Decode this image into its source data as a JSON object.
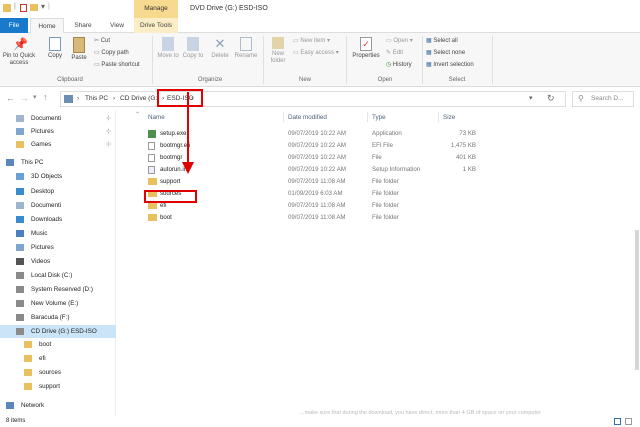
{
  "window": {
    "title": "DVD Drive (G:) ESD-ISO",
    "context_tab": "Manage"
  },
  "tabs": [
    "File",
    "Home",
    "Share",
    "View",
    "Drive Tools"
  ],
  "ribbon": {
    "clipboard": {
      "label": "Clipboard",
      "pin": "Pin to Quick access",
      "copy": "Copy",
      "paste": "Paste",
      "cut": "Cut",
      "copy_path": "Copy path",
      "paste_shortcut": "Paste shortcut"
    },
    "organize": {
      "label": "Organize",
      "move_to": "Move to",
      "copy_to": "Copy to",
      "delete": "Delete",
      "rename": "Rename"
    },
    "new": {
      "label": "New",
      "new_folder": "New folder",
      "new_item": "New item",
      "easy_access": "Easy access"
    },
    "open": {
      "label": "Open",
      "properties": "Properties",
      "open": "Open",
      "edit": "Edit",
      "history": "History"
    },
    "select": {
      "label": "Select",
      "select_all": "Select all",
      "select_none": "Select none",
      "invert": "Invert selection"
    }
  },
  "address": {
    "crumbs": [
      "This PC",
      "CD Drive (G:)",
      "ESD-ISO"
    ],
    "search_placeholder": "Search D..."
  },
  "nav": [
    {
      "label": "Documenti",
      "icon": "document-folder-icon",
      "pinned": true
    },
    {
      "label": "Pictures",
      "icon": "pictures-folder-icon",
      "pinned": true
    },
    {
      "label": "Games",
      "icon": "folder-icon",
      "pinned": true
    },
    {
      "label": "This PC",
      "icon": "computer-icon"
    },
    {
      "label": "3D Objects",
      "icon": "3d-objects-icon"
    },
    {
      "label": "Desktop",
      "icon": "desktop-icon"
    },
    {
      "label": "Documenti",
      "icon": "document-folder-icon"
    },
    {
      "label": "Downloads",
      "icon": "downloads-icon"
    },
    {
      "label": "Music",
      "icon": "music-icon"
    },
    {
      "label": "Pictures",
      "icon": "pictures-folder-icon"
    },
    {
      "label": "Videos",
      "icon": "videos-icon"
    },
    {
      "label": "Local Disk (C:)",
      "icon": "drive-icon"
    },
    {
      "label": "System Reserved (D:)",
      "icon": "drive-icon"
    },
    {
      "label": "New Volume (E:)",
      "icon": "drive-icon"
    },
    {
      "label": "Baracuda (F:)",
      "icon": "drive-icon"
    },
    {
      "label": "CD Drive (G:) ESD-ISO",
      "icon": "cd-drive-icon",
      "selected": true
    },
    {
      "label": "boot",
      "icon": "folder-icon"
    },
    {
      "label": "efi",
      "icon": "folder-icon"
    },
    {
      "label": "sources",
      "icon": "folder-icon"
    },
    {
      "label": "support",
      "icon": "folder-icon"
    },
    {
      "label": "Network",
      "icon": "network-icon"
    }
  ],
  "columns": [
    "Name",
    "Date modified",
    "Type",
    "Size"
  ],
  "files": [
    {
      "name": "setup.exe",
      "date": "09/07/2019 10:22 AM",
      "type": "Application",
      "size": "73 KB",
      "icon": "setup-icon"
    },
    {
      "name": "bootmgr.efi",
      "date": "09/07/2019 10:22 AM",
      "type": "EFI File",
      "size": "1,475 KB",
      "icon": "file-icon"
    },
    {
      "name": "bootmgr",
      "date": "09/07/2019 10:22 AM",
      "type": "File",
      "size": "401 KB",
      "icon": "file-icon"
    },
    {
      "name": "autorun.inf",
      "date": "09/07/2019 10:22 AM",
      "type": "Setup Information",
      "size": "1 KB",
      "icon": "settings-file-icon"
    },
    {
      "name": "support",
      "date": "09/07/2019 11:08 AM",
      "type": "File folder",
      "size": "",
      "icon": "folder-icon"
    },
    {
      "name": "sources",
      "date": "01/09/2019 6:03 AM",
      "type": "File folder",
      "size": "",
      "icon": "folder-icon"
    },
    {
      "name": "efi",
      "date": "09/07/2019 11:08 AM",
      "type": "File folder",
      "size": "",
      "icon": "folder-icon"
    },
    {
      "name": "boot",
      "date": "09/07/2019 11:08 AM",
      "type": "File folder",
      "size": "",
      "icon": "folder-icon"
    }
  ],
  "status": {
    "item_count": "8 items"
  },
  "overlay_text": "...make sure that during the download, you have direct, more than 4 GB of space on your computer",
  "colors": {
    "accent": "#1979ca",
    "highlight": "#e00000",
    "selected": "#cce4f7",
    "manage_tab": "#f7d98f"
  }
}
